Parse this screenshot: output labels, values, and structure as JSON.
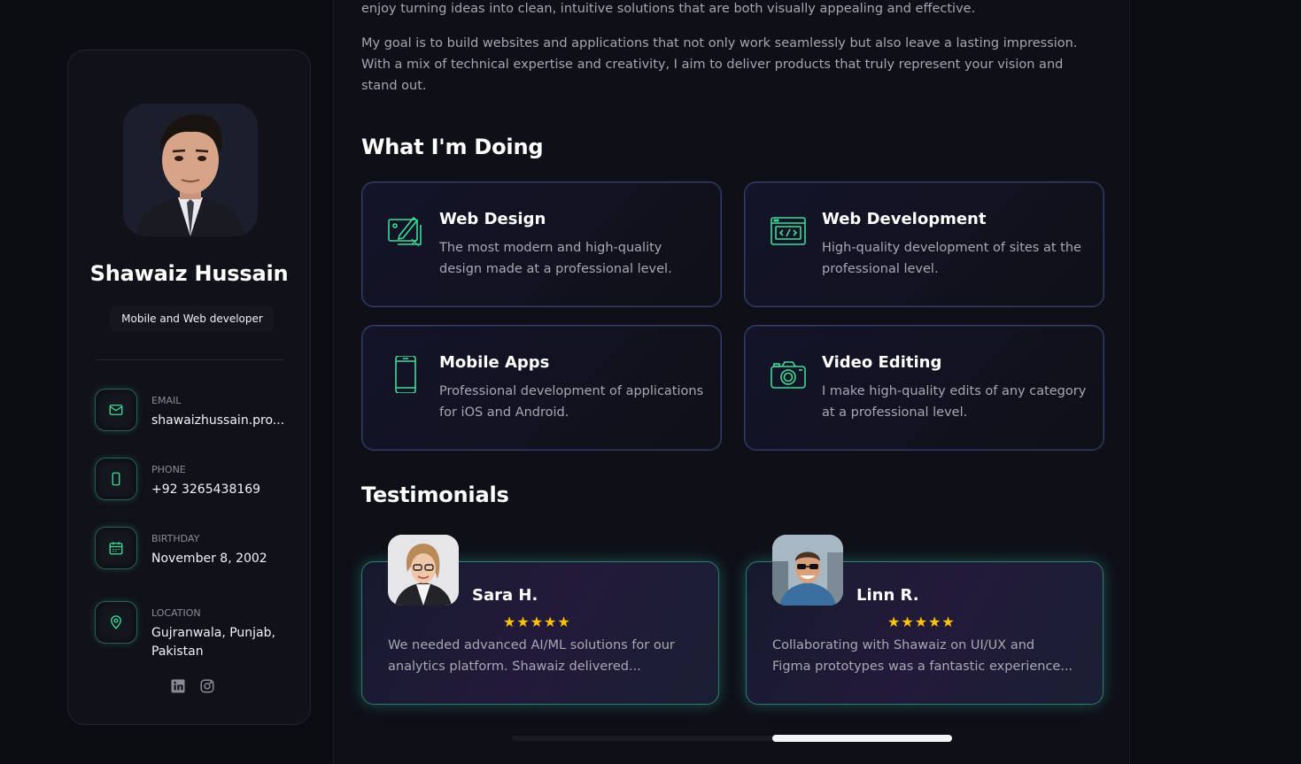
{
  "profile": {
    "name": "Shawaiz Hussain",
    "role": "Mobile and Web developer"
  },
  "contacts": [
    {
      "label": "EMAIL",
      "value": "shawaizhussain.pro...",
      "icon": "mail-icon"
    },
    {
      "label": "PHONE",
      "value": "+92 3265438169",
      "icon": "phone-icon"
    },
    {
      "label": "BIRTHDAY",
      "value": "November 8, 2002",
      "icon": "calendar-icon"
    },
    {
      "label": "LOCATION",
      "value": "Gujranwala, Punjab, Pakistan",
      "icon": "location-pin-icon"
    }
  ],
  "about": {
    "line1": "enjoy turning ideas into clean, intuitive solutions that are both visually appealing and effective.",
    "line2": "My goal is to build websites and applications that not only work seamlessly but also leave a lasting impression. With a mix of technical expertise and creativity, I aim to deliver products that truly represent your vision and stand out."
  },
  "services": {
    "title": "What I'm Doing",
    "items": [
      {
        "title": "Web Design",
        "text": "The most modern and high-quality design made at a professional level.",
        "icon": "design-icon"
      },
      {
        "title": "Web Development",
        "text": "High-quality development of sites at the professional level.",
        "icon": "code-icon"
      },
      {
        "title": "Mobile Apps",
        "text": "Professional development of applications for iOS and Android.",
        "icon": "mobile-icon"
      },
      {
        "title": "Video Editing",
        "text": "I make high-quality edits of any category at a professional level.",
        "icon": "camera-icon"
      }
    ]
  },
  "testimonials": {
    "title": "Testimonials",
    "items": [
      {
        "name": "Sara H.",
        "stars": "★★★★★",
        "line1": "We needed advanced AI/ML solutions for our",
        "line2": "analytics platform. Shawaiz delivered..."
      },
      {
        "name": "Linn R.",
        "stars": "★★★★★",
        "line1": "Collaborating with Shawaiz on UI/UX and",
        "line2": "Figma prototypes was a fantastic experience..."
      }
    ]
  },
  "colors": {
    "accent": "#3ddc97",
    "star": "#ffc400",
    "background": "#0c0c13"
  }
}
